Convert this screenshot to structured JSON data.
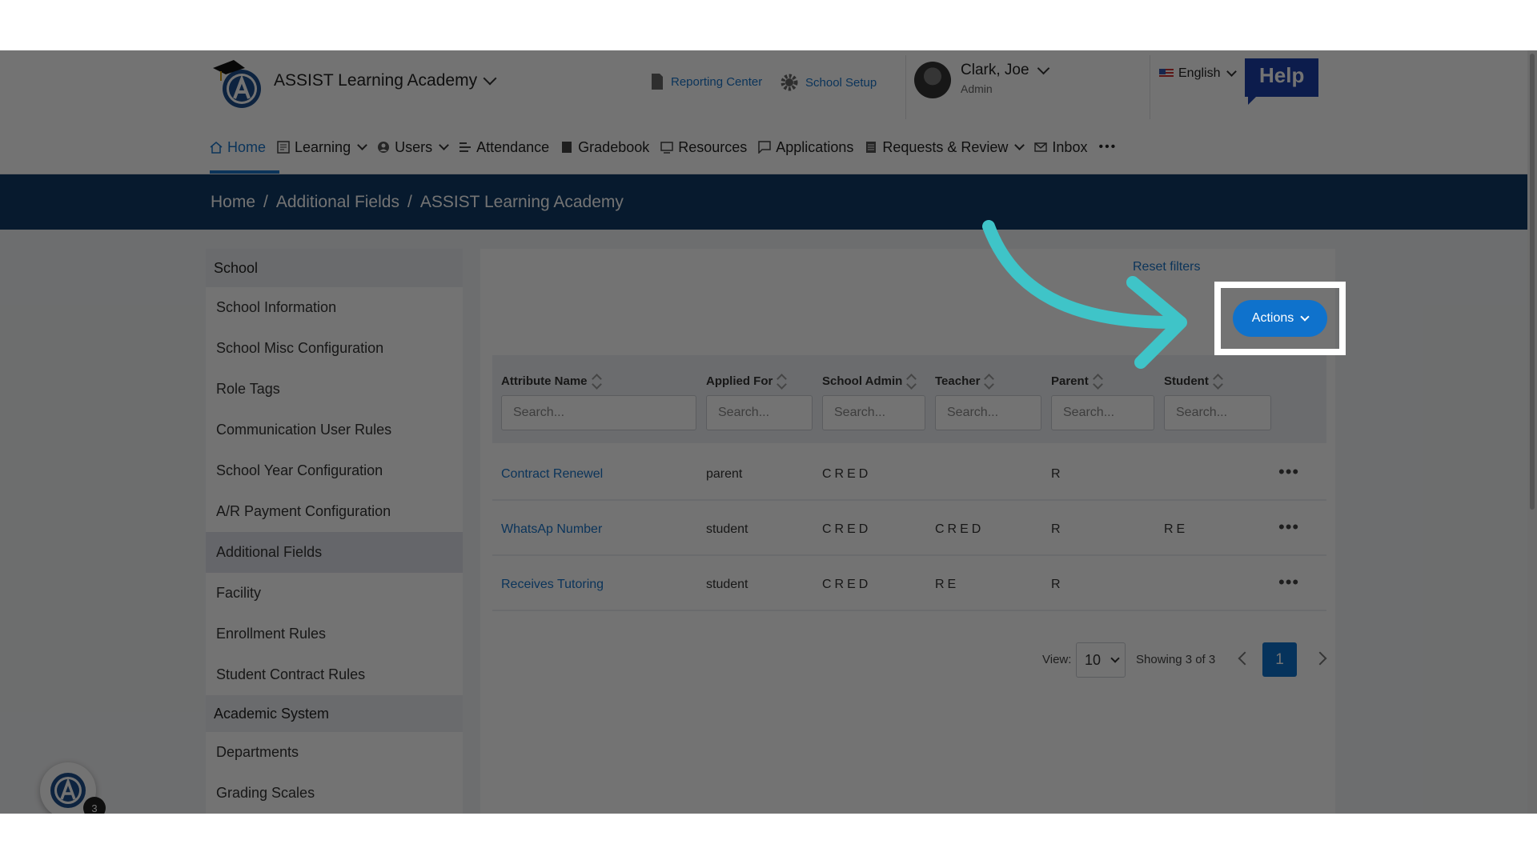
{
  "header": {
    "school_name": "ASSIST Learning Academy",
    "reporting_center": "Reporting Center",
    "school_setup": "School Setup",
    "user_name": "Clark, Joe",
    "user_role": "Admin",
    "language": "English",
    "help_label": "Help"
  },
  "nav": {
    "items": [
      {
        "label": "Home",
        "icon": "home-icon"
      },
      {
        "label": "Learning",
        "icon": "learning-icon"
      },
      {
        "label": "Users",
        "icon": "user-icon"
      },
      {
        "label": "Attendance",
        "icon": "attendance-icon"
      },
      {
        "label": "Gradebook",
        "icon": "gradebook-icon"
      },
      {
        "label": "Resources",
        "icon": "resources-icon"
      },
      {
        "label": "Applications",
        "icon": "applications-icon"
      },
      {
        "label": "Requests & Review",
        "icon": "requests-icon"
      },
      {
        "label": "Inbox",
        "icon": "inbox-icon"
      }
    ],
    "more": "•••"
  },
  "breadcrumb": [
    "Home",
    "Additional Fields",
    "ASSIST Learning Academy"
  ],
  "sidebar": {
    "section_school": "School",
    "items": [
      "School Information",
      "School Misc Configuration",
      "Role Tags",
      "Communication User Rules",
      "School Year Configuration",
      "A/R Payment Configuration",
      "Additional Fields",
      "Facility",
      "Enrollment Rules",
      "Student Contract Rules"
    ],
    "section_academic": "Academic System",
    "items2": [
      "Departments",
      "Grading Scales"
    ]
  },
  "toolbar": {
    "filter_link": "Reset filters",
    "actions_label": "Actions"
  },
  "table": {
    "columns": [
      "Attribute Name",
      "Applied For",
      "School Admin",
      "Teacher",
      "Parent",
      "Student"
    ],
    "search_placeholder": "Search...",
    "rows": [
      {
        "name": "Contract Renewel",
        "applied_for": "parent",
        "school_admin": "CRED",
        "teacher": "",
        "parent": "R",
        "student": ""
      },
      {
        "name": "WhatsAp Number",
        "applied_for": "student",
        "school_admin": "CRED",
        "teacher": "CRED",
        "parent": "R",
        "student": "RE"
      },
      {
        "name": "Receives Tutoring",
        "applied_for": "student",
        "school_admin": "CRED",
        "teacher": "RE",
        "parent": "R",
        "student": ""
      }
    ]
  },
  "pagination": {
    "view_label": "View:",
    "page_size": "10",
    "showing": "Showing 3 of 3",
    "current_page": "1"
  },
  "floating": {
    "badge_count": "3"
  },
  "colors": {
    "accent": "#0f72cc",
    "navy": "#103a66",
    "arrow": "#3fc4c8"
  }
}
